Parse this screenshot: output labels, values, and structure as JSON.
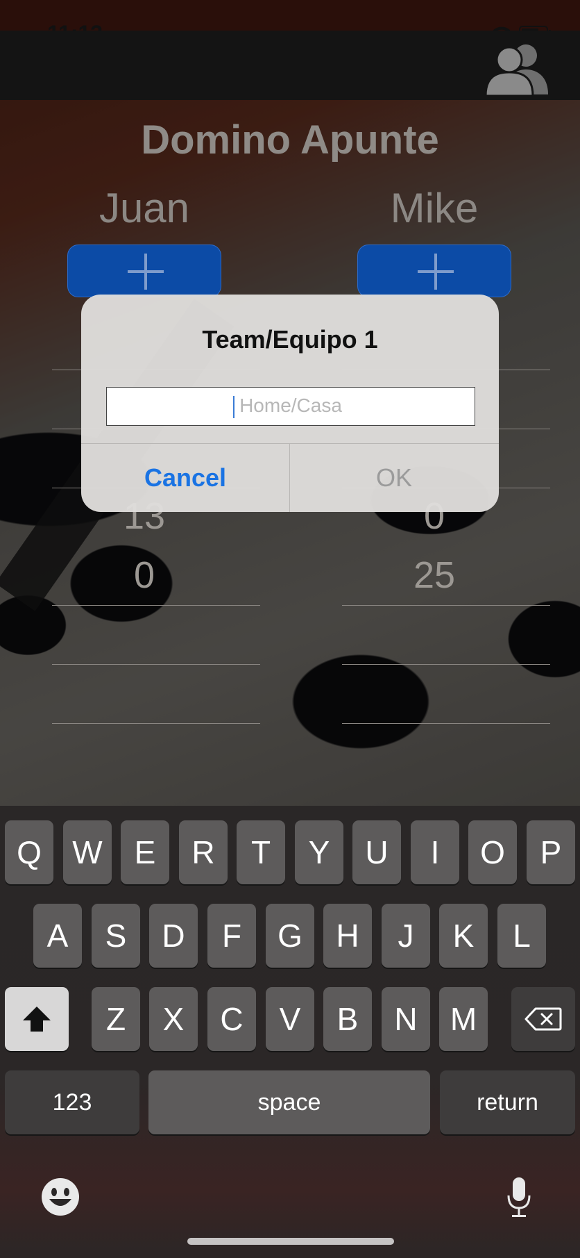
{
  "status": {
    "time": "11:13"
  },
  "nav": {
    "team_icon": "group-icon"
  },
  "app": {
    "title": "Domino Apunte",
    "players": [
      {
        "name": "Juan",
        "add_label": "+"
      },
      {
        "name": "Mike",
        "add_label": "+"
      }
    ],
    "scores": {
      "left": [
        "13",
        "0"
      ],
      "right": [
        "0",
        "25"
      ]
    }
  },
  "dialog": {
    "title": "Team/Equipo 1",
    "input_value": "",
    "input_placeholder": "Home/Casa",
    "cancel_label": "Cancel",
    "ok_label": "OK"
  },
  "keyboard": {
    "row1": [
      "Q",
      "W",
      "E",
      "R",
      "T",
      "Y",
      "U",
      "I",
      "O",
      "P"
    ],
    "row2": [
      "A",
      "S",
      "D",
      "F",
      "G",
      "H",
      "J",
      "K",
      "L"
    ],
    "row3": [
      "Z",
      "X",
      "C",
      "V",
      "B",
      "N",
      "M"
    ],
    "numbers_label": "123",
    "space_label": "space",
    "return_label": "return"
  },
  "colors": {
    "accent_blue": "#1a73e3",
    "button_blue": "#0c4ba6"
  }
}
